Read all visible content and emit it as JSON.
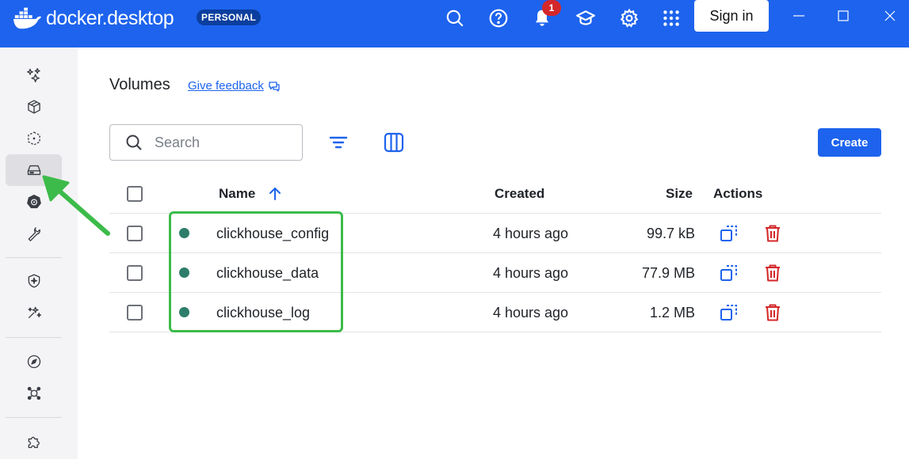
{
  "app": {
    "brand_docker": "docker",
    "brand_desktop": "desktop",
    "plan_badge": "PERSONAL",
    "notification_count": "1",
    "sign_in_label": "Sign in"
  },
  "colors": {
    "brand_blue": "#1d63ed",
    "badge_dark": "#0b3e9e",
    "in_use_dot": "#2e7d6b",
    "delete_red": "#d4272a",
    "annotation_green": "#3cbb4a"
  },
  "topbar_icons": [
    "search-icon",
    "help-icon",
    "bell-icon",
    "learning-icon",
    "gear-icon",
    "grid-icon"
  ],
  "sidebar": {
    "items": [
      {
        "icon": "ask-gordon-icon"
      },
      {
        "icon": "containers-icon"
      },
      {
        "icon": "images-icon"
      },
      {
        "icon": "volumes-icon",
        "active": true
      },
      {
        "icon": "kubernetes-icon"
      },
      {
        "icon": "dev-tools-icon"
      },
      {
        "icon": "scout-icon"
      },
      {
        "icon": "models-icon"
      },
      {
        "icon": "docs-icon"
      },
      {
        "icon": "mcp-icon"
      },
      {
        "icon": "extensions-icon"
      }
    ]
  },
  "page": {
    "title": "Volumes",
    "feedback_label": "Give feedback",
    "search_placeholder": "Search",
    "create_label": "Create"
  },
  "table": {
    "headers": {
      "name": "Name",
      "created": "Created",
      "size": "Size",
      "actions": "Actions"
    },
    "sort": {
      "column": "name",
      "direction": "ascending"
    },
    "rows": [
      {
        "name": "clickhouse_config",
        "created": "4 hours ago",
        "size": "99.7 kB",
        "in_use": true
      },
      {
        "name": "clickhouse_data",
        "created": "4 hours ago",
        "size": "77.9 MB",
        "in_use": true
      },
      {
        "name": "clickhouse_log",
        "created": "4 hours ago",
        "size": "1.2 MB",
        "in_use": true
      }
    ]
  }
}
